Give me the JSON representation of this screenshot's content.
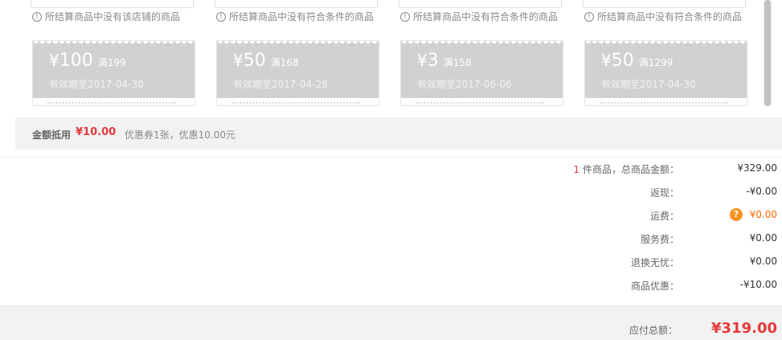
{
  "coupons": [
    {
      "notice": "所结算商品中没有该店铺的商品",
      "symbol": "¥",
      "amount": "100",
      "condition": "满199",
      "validity": "有效期至2017-04-30"
    },
    {
      "notice": "所结算商品中没有符合条件的商品",
      "symbol": "¥",
      "amount": "50",
      "condition": "满168",
      "validity": "有效期至2017-04-28"
    },
    {
      "notice": "所结算商品中没有符合条件的商品",
      "symbol": "¥",
      "amount": "3",
      "condition": "满158",
      "validity": "有效期至2017-06-06"
    },
    {
      "notice": "所结算商品中没有符合条件的商品",
      "symbol": "¥",
      "amount": "50",
      "condition": "满1299",
      "validity": "有效期至2017-04-30"
    }
  ],
  "summary": {
    "label": "金额抵用",
    "amount": "¥10.00",
    "description": "优惠券1张，优惠10.00元"
  },
  "totals": {
    "count": "1",
    "goods_label": "件商品，总商品金额：",
    "goods_value": "¥329.00",
    "cashback_label": "返现：",
    "cashback_value": "-¥0.00",
    "shipping_label": "运费：",
    "shipping_value": "¥0.00",
    "service_label": "服务费：",
    "service_value": "¥0.00",
    "return_label": "退换无忧：",
    "return_value": "¥0.00",
    "discount_label": "商品优惠：",
    "discount_value": "-¥10.00"
  },
  "payable": {
    "label": "应付总额：",
    "amount": "¥319.00"
  },
  "colors": {
    "accent_red": "#e4393c",
    "shipping_orange": "#f60",
    "help_icon": "#f7931e",
    "coupon_gray": "#d1d1d1"
  },
  "icons": {
    "notice": "info-circle-icon",
    "help": "question-icon"
  }
}
